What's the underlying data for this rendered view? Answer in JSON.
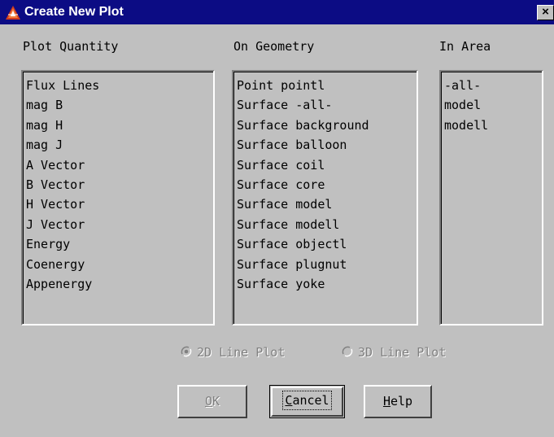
{
  "window": {
    "title": "Create New Plot",
    "close_glyph": "×",
    "colors": {
      "titlebar": "#0c0c84",
      "face": "#c0c0c0",
      "disabled_text": "#808080"
    }
  },
  "columns": {
    "plot_quantity": {
      "label": "Plot Quantity",
      "items": [
        "Flux Lines",
        "mag B",
        "mag H",
        "mag J",
        "A Vector",
        "B Vector",
        "H Vector",
        "J Vector",
        "Energy",
        "Coenergy",
        "Appenergy"
      ]
    },
    "on_geometry": {
      "label": "On Geometry",
      "items": [
        "Point pointl",
        "Surface -all-",
        "Surface background",
        "Surface balloon",
        "Surface coil",
        "Surface core",
        "Surface model",
        "Surface modell",
        "Surface objectl",
        "Surface plugnut",
        "Surface yoke"
      ]
    },
    "in_area": {
      "label": "In Area",
      "items": [
        "-all-",
        "model",
        "modell"
      ]
    }
  },
  "plot_type": {
    "options": [
      {
        "label": "2D Line Plot",
        "selected": true,
        "enabled": false
      },
      {
        "label": "3D Line Plot",
        "selected": false,
        "enabled": false
      }
    ]
  },
  "buttons": {
    "ok": {
      "mnemonic": "O",
      "rest": "K",
      "enabled": false
    },
    "cancel": {
      "mnemonic": "C",
      "rest": "ancel",
      "enabled": true,
      "focused": true
    },
    "help": {
      "mnemonic": "H",
      "rest": "elp",
      "enabled": true
    }
  },
  "icons": {
    "app": "triangle-logo-icon",
    "close": "close-icon",
    "radio": "radio-icon"
  }
}
